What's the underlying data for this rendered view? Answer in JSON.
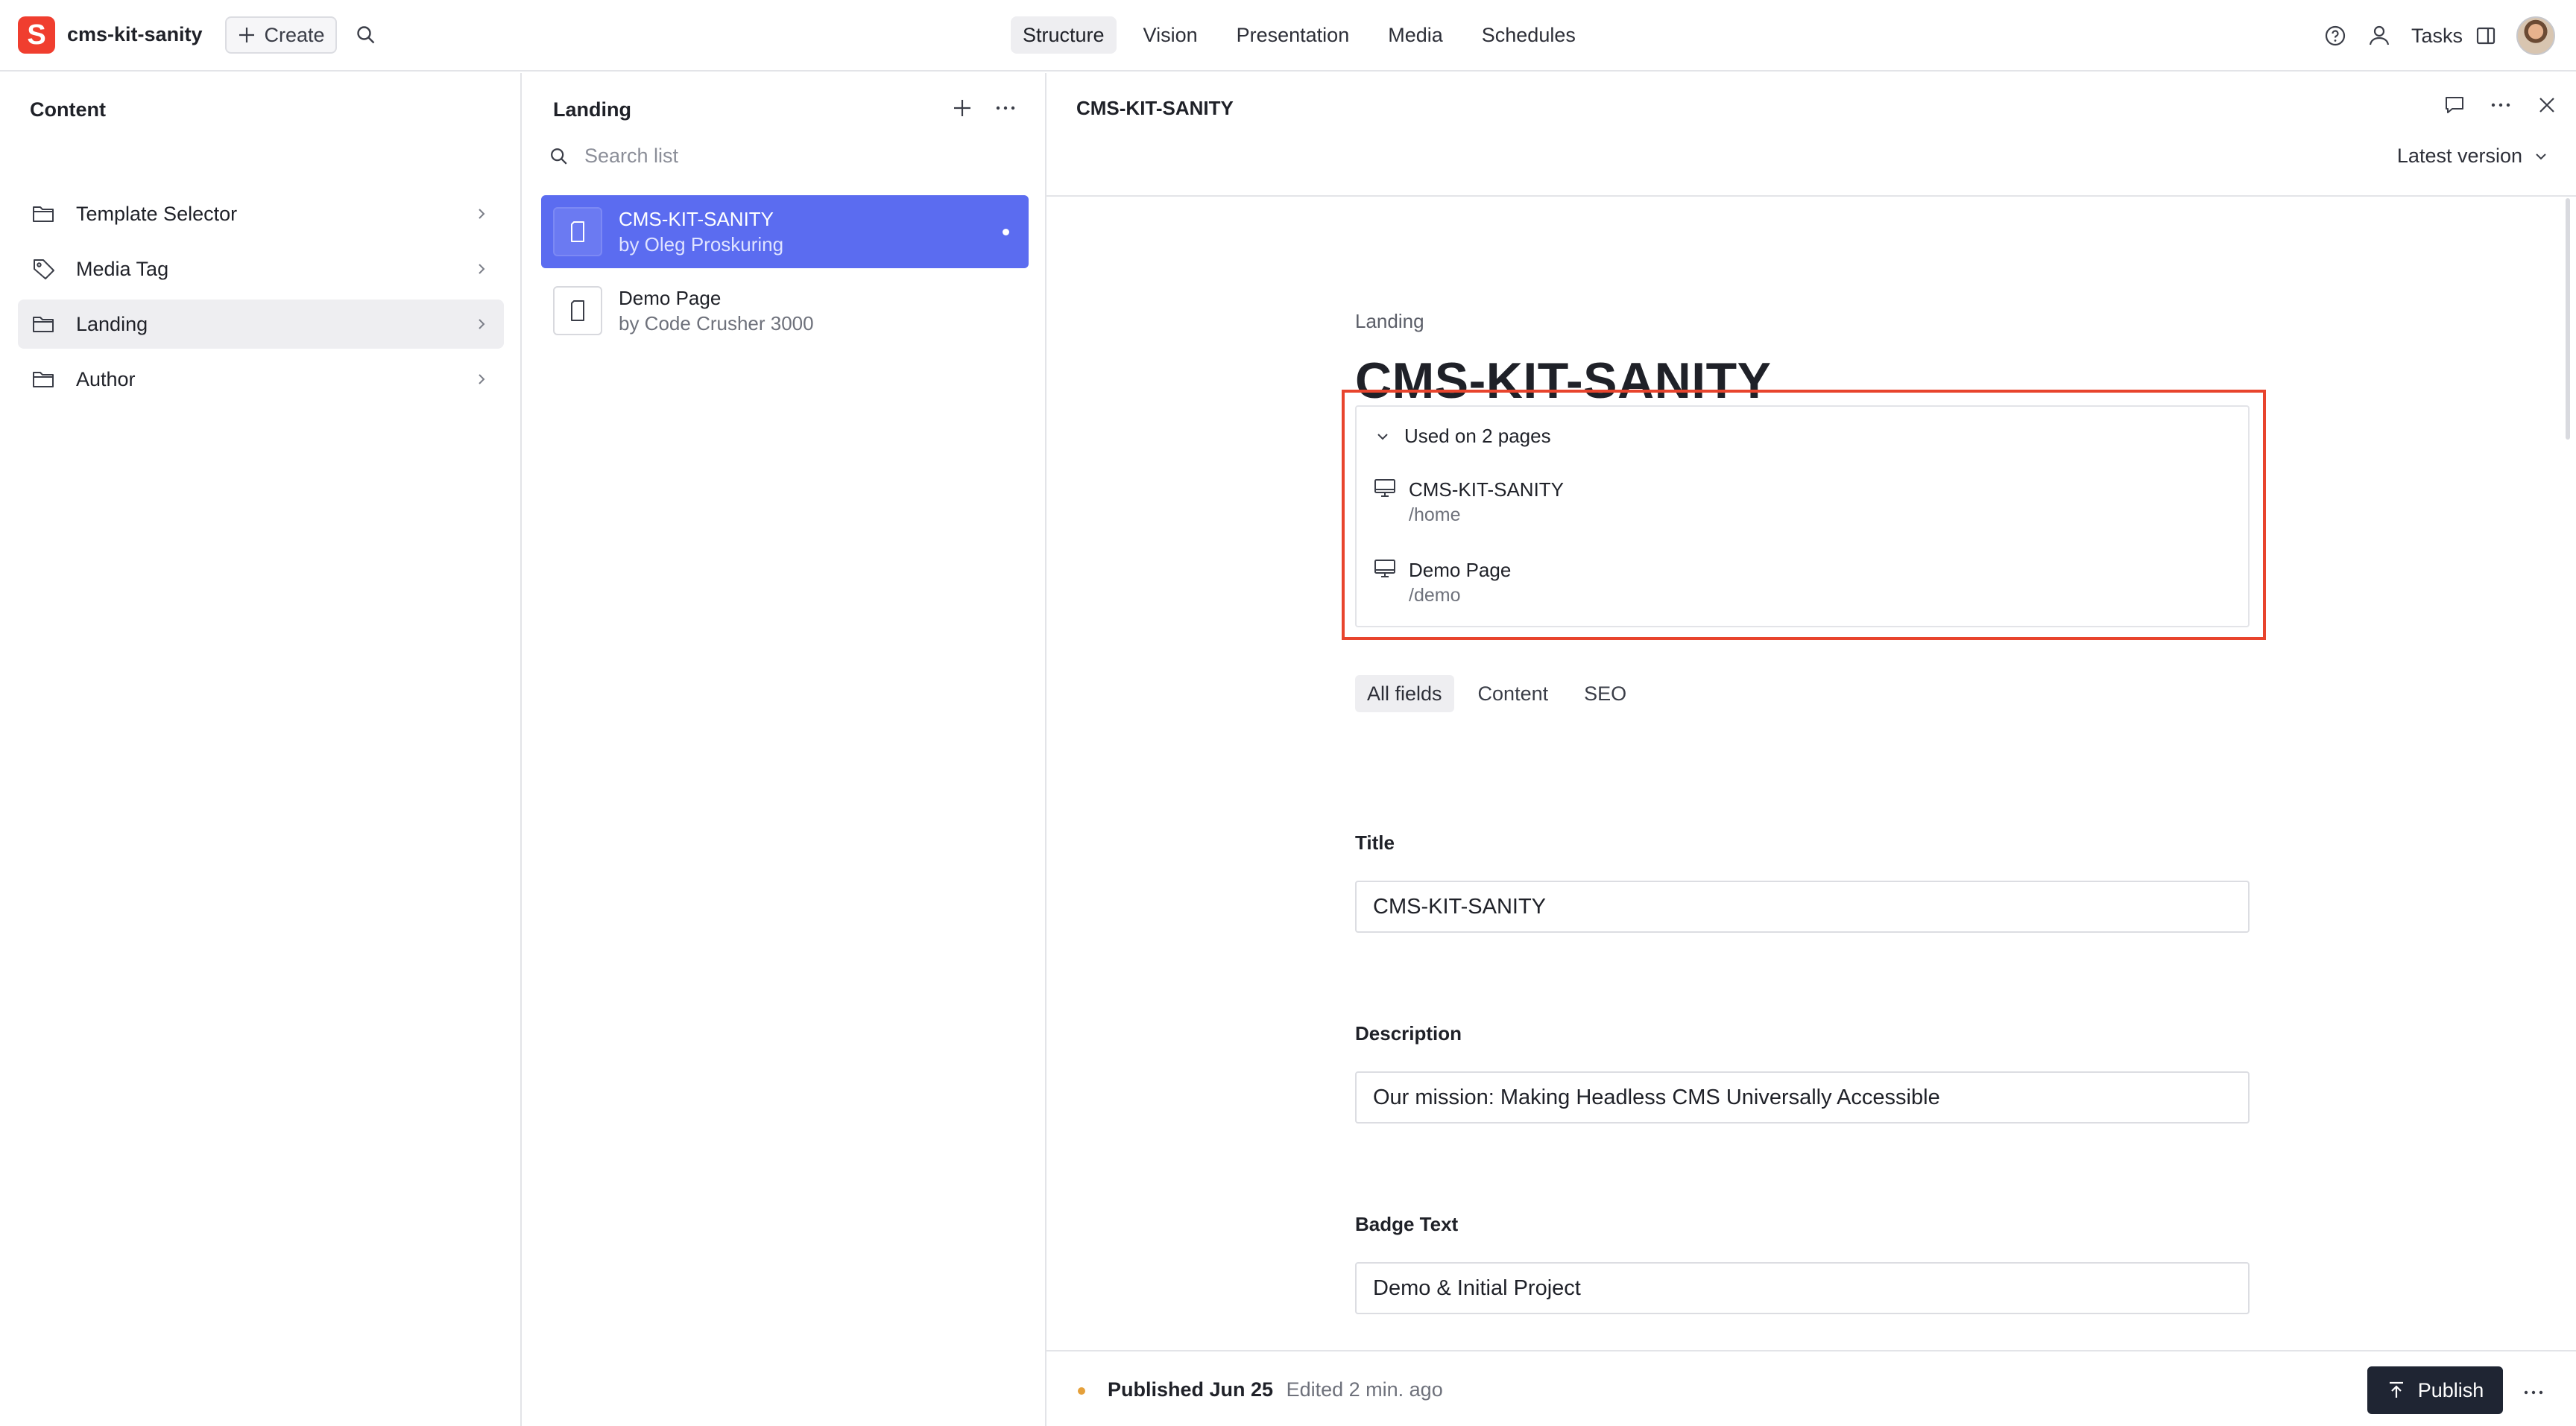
{
  "app": {
    "logo_letter": "S",
    "workspace_name": "cms-kit-sanity",
    "create_label": "Create",
    "brand_color": "#f03e2f"
  },
  "nav": {
    "items": [
      "Structure",
      "Vision",
      "Presentation",
      "Media",
      "Schedules"
    ],
    "active": "Structure"
  },
  "top_right": {
    "tasks_label": "Tasks",
    "icons": [
      "help-icon",
      "user-presence-icon",
      "split-pane-icon",
      "avatar"
    ]
  },
  "content_pane": {
    "title": "Content",
    "items": [
      {
        "label": "Template Selector",
        "icon": "folder-icon"
      },
      {
        "label": "Media Tag",
        "icon": "tag-icon"
      },
      {
        "label": "Landing",
        "icon": "folder-icon",
        "selected": true
      },
      {
        "label": "Author",
        "icon": "folder-icon"
      }
    ]
  },
  "landing_pane": {
    "title": "Landing",
    "search_placeholder": "Search list",
    "documents": [
      {
        "title": "CMS-KIT-SANITY",
        "subtitle": "by Oleg Proskuring",
        "selected": true
      },
      {
        "title": "Demo Page",
        "subtitle": "by Code Crusher 3000",
        "selected": false
      }
    ],
    "selected_color": "#5b6cf0"
  },
  "document": {
    "header_title": "CMS-KIT-SANITY",
    "version_label": "Latest version",
    "type_label": "Landing",
    "heading": "CMS-KIT-SANITY",
    "usage": {
      "summary": "Used on 2 pages",
      "pages": [
        {
          "title": "CMS-KIT-SANITY",
          "path": "/home"
        },
        {
          "title": "Demo Page",
          "path": "/demo"
        }
      ],
      "highlight_color": "#e8442d"
    },
    "tabs": [
      "All fields",
      "Content",
      "SEO"
    ],
    "active_tab": "All fields",
    "fields": {
      "title": {
        "label": "Title",
        "value": "CMS-KIT-SANITY"
      },
      "description": {
        "label": "Description",
        "value": "Our mission: Making Headless CMS Universally Accessible"
      },
      "badge_text": {
        "label": "Badge Text",
        "value": "Demo & Initial Project"
      }
    }
  },
  "footer": {
    "published_label": "Published Jun 25",
    "edited_label": "Edited 2 min. ago",
    "publish_button": "Publish",
    "status_color": "#e5a03a"
  }
}
